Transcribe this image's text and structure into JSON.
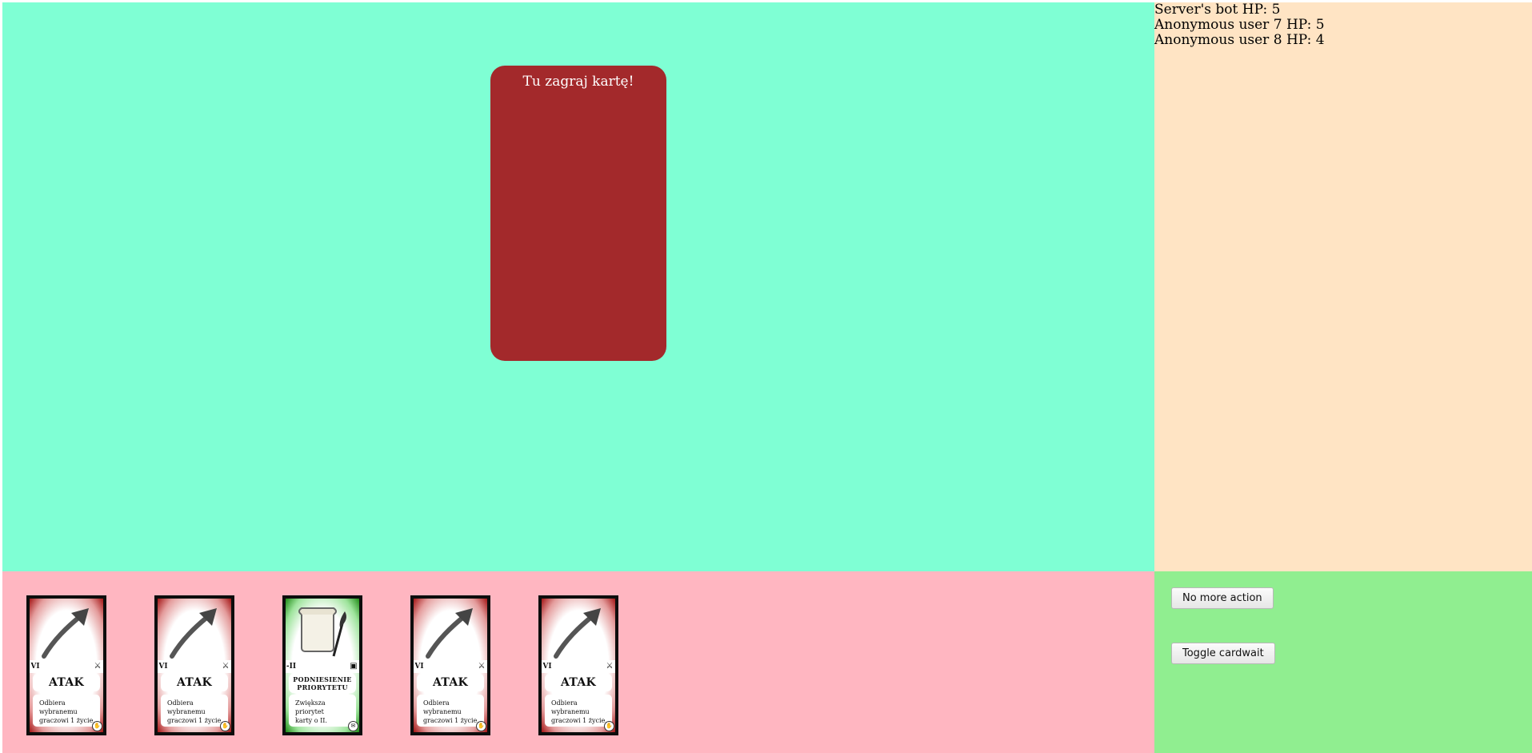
{
  "play_zone": {
    "label": "Tu zagraj kartę!"
  },
  "players": [
    {
      "name": "Server's bot",
      "hp_label": "HP:",
      "hp": "5"
    },
    {
      "name": "Anonymous user 7",
      "hp_label": "HP:",
      "hp": "5"
    },
    {
      "name": "Anonymous user 8",
      "hp_label": "HP:",
      "hp": "4"
    }
  ],
  "actions": {
    "no_more_action": "No more action",
    "toggle_cardwait": "Toggle cardwait"
  },
  "hand": [
    {
      "title": "ATAK",
      "number": "VI",
      "desc_line1": "Odbiera wybranemu",
      "desc_line2": "graczowi 1 życie.",
      "art_icon": "arrow-icon",
      "type_icon": "sword-icon",
      "frame": "red"
    },
    {
      "title": "ATAK",
      "number": "VI",
      "desc_line1": "Odbiera wybranemu",
      "desc_line2": "graczowi 1 życie.",
      "art_icon": "arrow-icon",
      "type_icon": "sword-icon",
      "frame": "red"
    },
    {
      "title_line1": "PODNIESIENIE",
      "title_line2": "PRIORYTETU",
      "number": "-II",
      "desc_line1": "Zwiększa priorytet",
      "desc_line2": "karty o II.",
      "art_icon": "scroll-quill-icon",
      "type_icon": "priority-icon",
      "frame": "green"
    },
    {
      "title": "ATAK",
      "number": "VI",
      "desc_line1": "Odbiera wybranemu",
      "desc_line2": "graczowi 1 życie.",
      "art_icon": "arrow-icon",
      "type_icon": "sword-icon",
      "frame": "red"
    },
    {
      "title": "ATAK",
      "number": "VI",
      "desc_line1": "Odbiera wybranemu",
      "desc_line2": "graczowi 1 życie.",
      "art_icon": "arrow-icon",
      "type_icon": "sword-icon",
      "frame": "red"
    }
  ],
  "colors": {
    "board": "#7fffd4",
    "play_zone": "#a3292b",
    "players_panel": "#ffe4c4",
    "hand_area": "#ffb6c1",
    "actions_panel": "#90ee90"
  }
}
